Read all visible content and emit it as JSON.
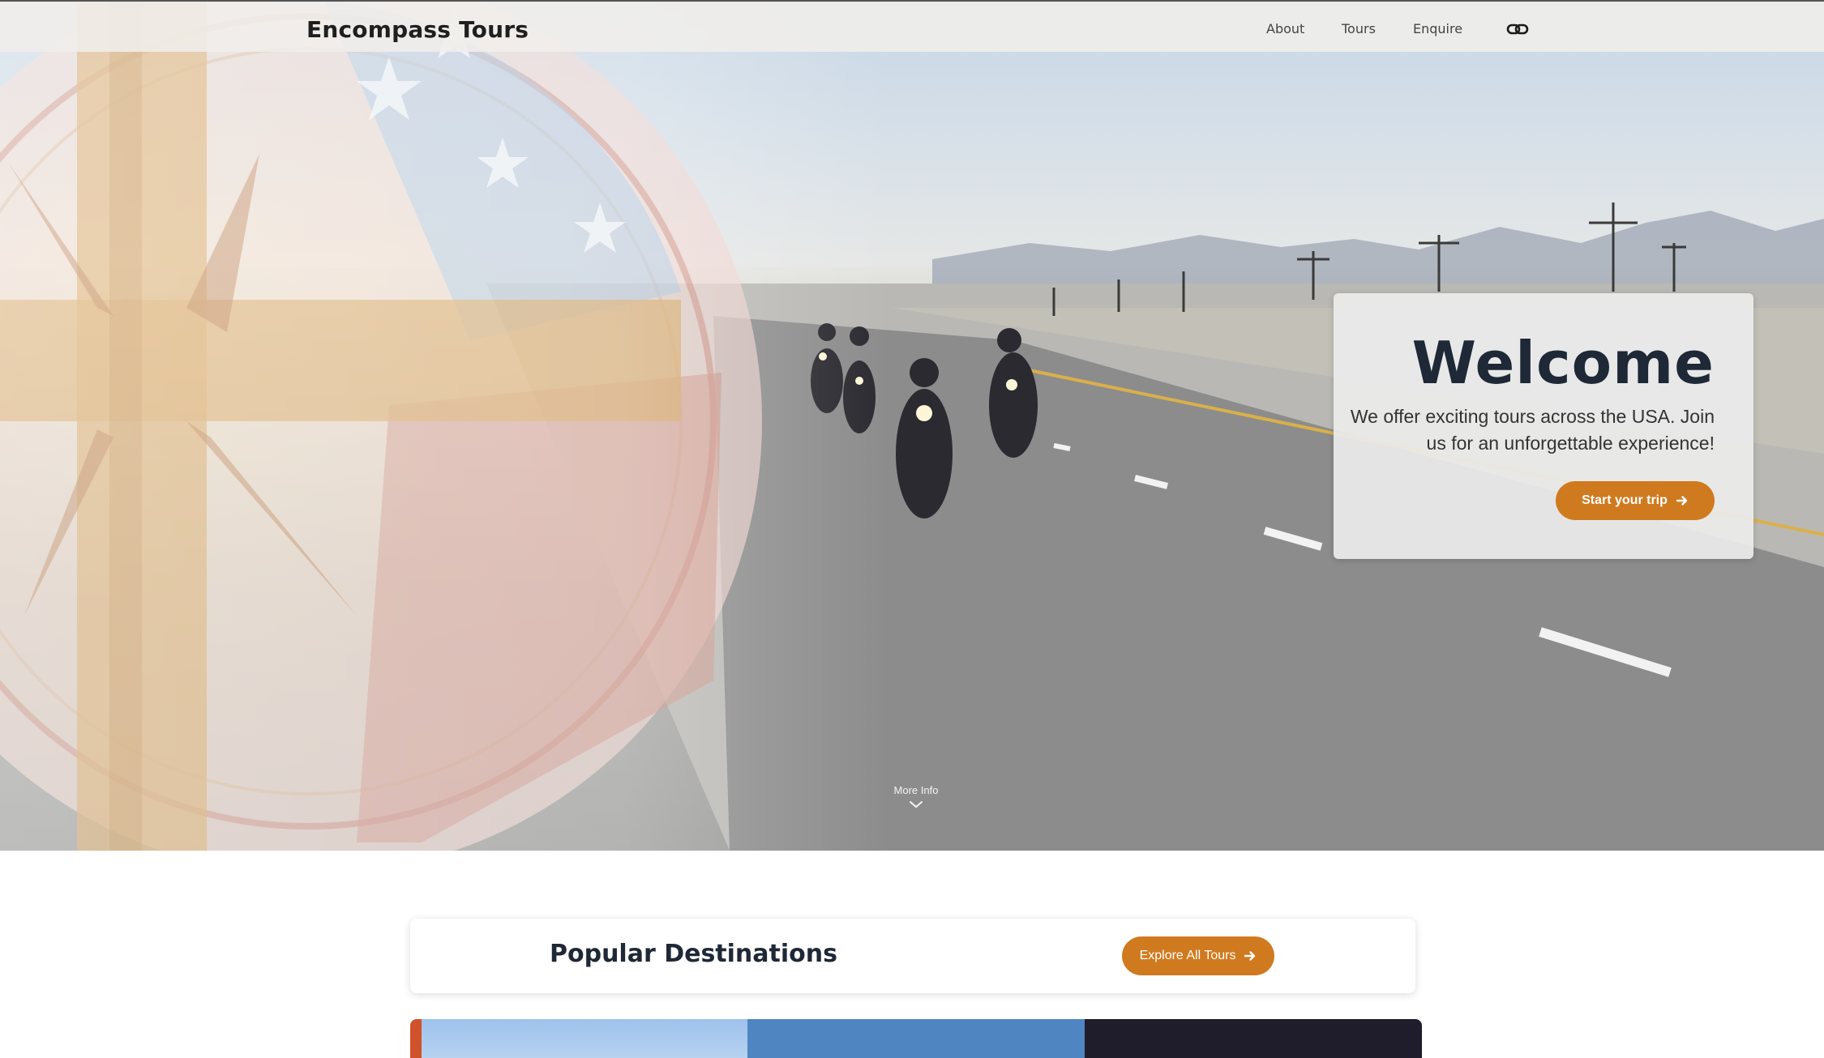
{
  "navbar": {
    "brand": "Encompass Tours",
    "links": [
      {
        "label": "About"
      },
      {
        "label": "Tours"
      },
      {
        "label": "Enquire"
      }
    ],
    "icon": "link-icon"
  },
  "hero": {
    "title": "Welcome",
    "description": "We offer exciting tours across the USA. Join us for an unforgettable experience!",
    "cta_label": "Start your trip",
    "more_info_label": "More Info",
    "background": "motorcycle-road-with-compass-overlay"
  },
  "destinations": {
    "title": "Popular Destinations",
    "explore_label": "Explore All Tours"
  },
  "colors": {
    "accent": "#d07a1f",
    "heading": "#1e2836"
  }
}
